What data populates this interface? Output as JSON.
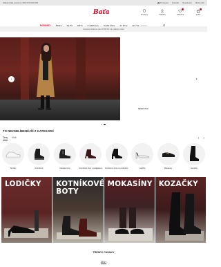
{
  "topbar": {
    "hotline": "Zákaznická podpora: 800 070 000 000",
    "links": [
      "Prodejny",
      "Kontakt",
      "Newsletter",
      "Baťa club"
    ]
  },
  "header": {
    "icons": [
      {
        "label": "Prodejny",
        "icon": "location-icon"
      },
      {
        "label": "Přihlásit",
        "icon": "user-icon"
      },
      {
        "label": "Oblíbené",
        "icon": "heart-icon"
      },
      {
        "label": "Košík",
        "icon": "bag-icon"
      }
    ],
    "search_placeholder": "Hledat"
  },
  "nav": {
    "items": [
      "NOVINKY",
      "ŽENY",
      "MUŽI",
      "DĚTI",
      "KABELKY",
      "DOPLŇKY",
      "SLEVY",
      "BLOG"
    ],
    "active_index": 0
  },
  "promo": {
    "text": "Doprava zdarma nad 1 500 Kč na výdejní místa"
  },
  "hero": {
    "cta": "Zjistit více",
    "slides": 2,
    "active_slide": 0
  },
  "categories": {
    "title": "TO NEJOBLÍBENĚJŠÍ Z KATEGORIÍ",
    "tabs": [
      "Ženy",
      "Muži"
    ],
    "active_tab": 0,
    "items": [
      {
        "label": "Tenisky"
      },
      {
        "label": "Kotníkové"
      },
      {
        "label": "Chelsea boty"
      },
      {
        "label": "Kotníkové boty s podpatkem"
      },
      {
        "label": "Kotníkové boty na podpatku"
      },
      {
        "label": "Lodičky"
      },
      {
        "label": "Mokasíny"
      },
      {
        "label": "Kozačky"
      }
    ]
  },
  "tiles": [
    {
      "label": "LODIČKY"
    },
    {
      "label": "KOTNÍKOVÉ BOTY"
    },
    {
      "label": "MOKASÍNY"
    },
    {
      "label": "KOZAČKY"
    }
  ],
  "trending": {
    "title": "TRENDY CHUNKY",
    "tab": "ŽENY"
  },
  "colors": {
    "brand": "#d6001c"
  }
}
